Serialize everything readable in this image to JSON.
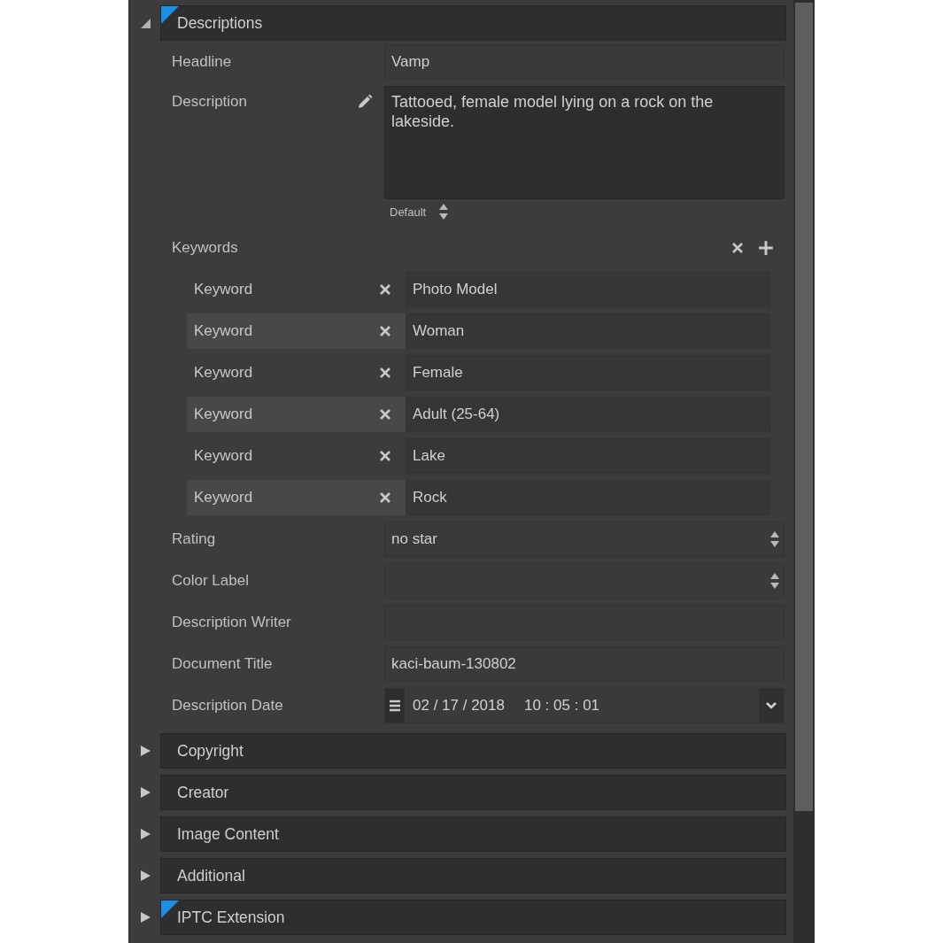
{
  "sections": [
    {
      "title": "Descriptions",
      "expanded": true,
      "modified": true,
      "fields": [
        {
          "kind": "text",
          "label": "Headline",
          "value": "Vamp"
        },
        {
          "kind": "textarea",
          "label": "Description",
          "value": "Tattooed, female model lying on a rock on the lakeside.",
          "variant": "Default"
        },
        {
          "kind": "keywords",
          "label": "Keywords",
          "items": [
            {
              "label": "Keyword",
              "value": "Photo Model"
            },
            {
              "label": "Keyword",
              "value": "Woman"
            },
            {
              "label": "Keyword",
              "value": "Female"
            },
            {
              "label": "Keyword",
              "value": "Adult (25-64)"
            },
            {
              "label": "Keyword",
              "value": "Lake"
            },
            {
              "label": "Keyword",
              "value": "Rock"
            }
          ]
        },
        {
          "kind": "select",
          "label": "Rating",
          "value": "no star"
        },
        {
          "kind": "select",
          "label": "Color Label"
        },
        {
          "kind": "text",
          "label": "Description Writer"
        },
        {
          "kind": "text",
          "label": "Document Title",
          "value": "kaci-baum-130802"
        },
        {
          "kind": "datetime",
          "label": "Description Date",
          "date": "02 / 17 / 2018",
          "time": "10 : 05 : 01"
        }
      ]
    },
    {
      "title": "Copyright",
      "expanded": false,
      "modified": false
    },
    {
      "title": "Creator",
      "expanded": false,
      "modified": false
    },
    {
      "title": "Image Content",
      "expanded": false,
      "modified": false
    },
    {
      "title": "Additional",
      "expanded": false,
      "modified": false
    },
    {
      "title": "IPTC Extension",
      "expanded": false,
      "modified": true
    }
  ]
}
